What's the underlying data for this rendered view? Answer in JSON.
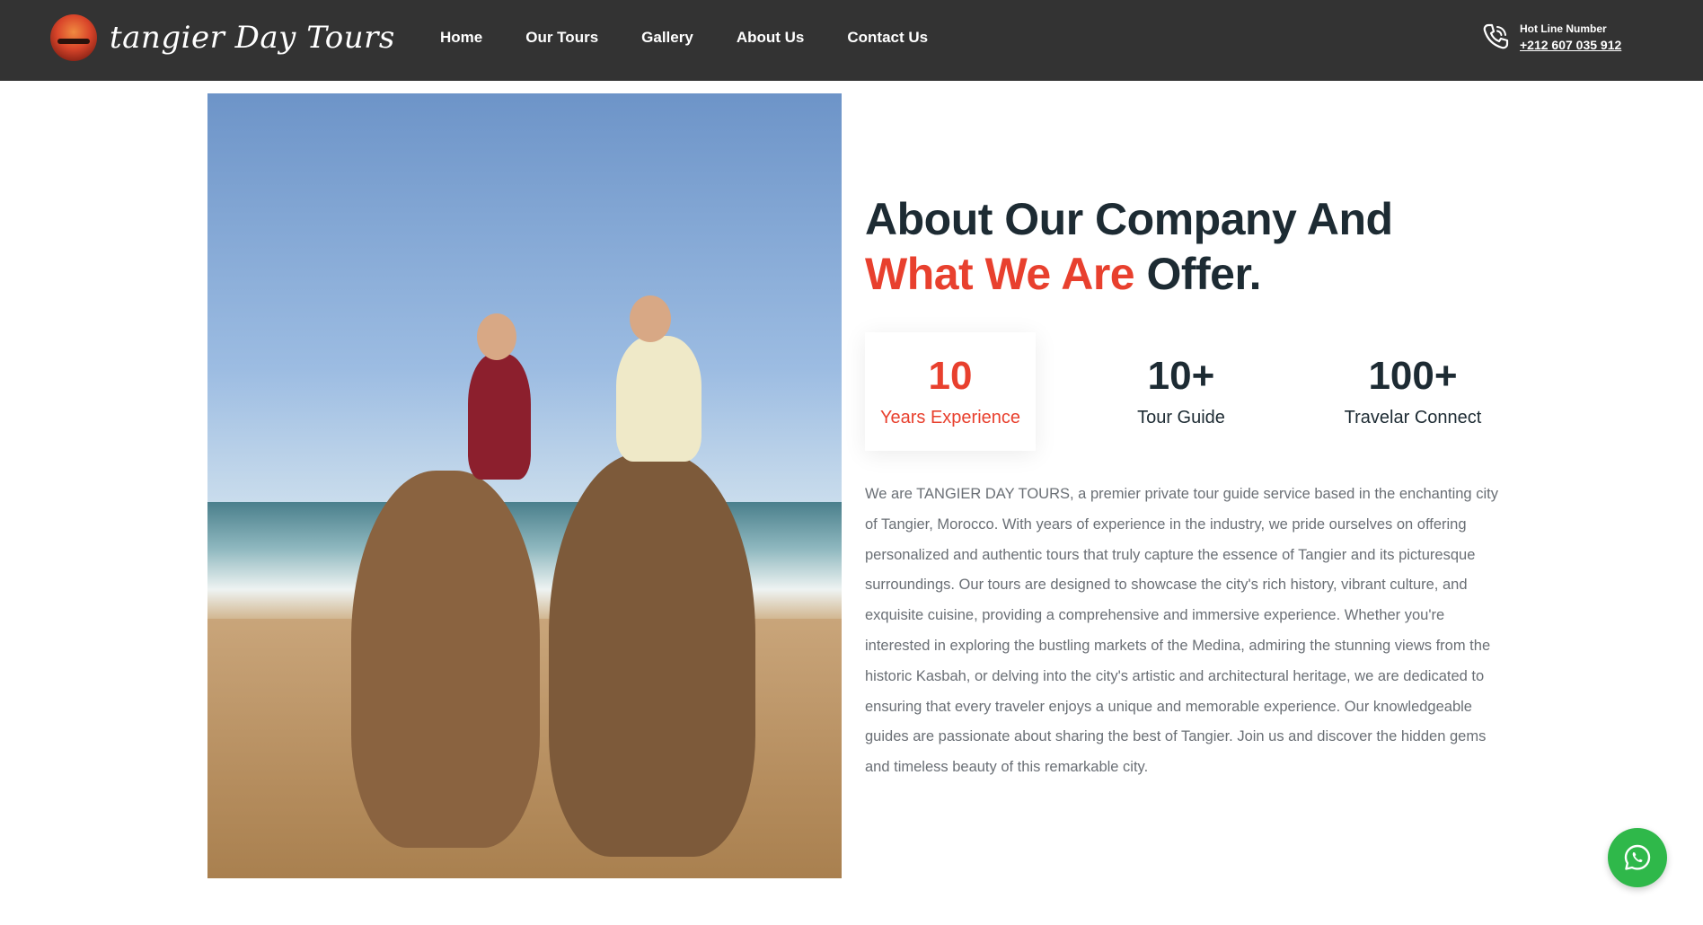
{
  "header": {
    "logo_text": "tangier Day Tours",
    "nav": [
      {
        "label": "Home"
      },
      {
        "label": "Our Tours"
      },
      {
        "label": "Gallery"
      },
      {
        "label": "About Us"
      },
      {
        "label": "Contact Us"
      }
    ],
    "hotline_label": "Hot Line Number",
    "hotline_number": "+212 607 035 912",
    "phone_icon": "phone-icon"
  },
  "about": {
    "heading_part1": "About Our Company And ",
    "heading_accent": "What We Are",
    "heading_part2": " Offer.",
    "stats": [
      {
        "value": "10",
        "label": "Years Experience"
      },
      {
        "value": "10+",
        "label": "Tour Guide"
      },
      {
        "value": "100+",
        "label": "Travelar Connect"
      }
    ],
    "description": "We are TANGIER DAY TOURS, a premier private tour guide service based in the enchanting city of Tangier, Morocco. With years of experience in the industry, we pride ourselves on offering personalized and authentic tours that truly capture the essence of Tangier and its picturesque surroundings. Our tours are designed to showcase the city's rich history, vibrant culture, and exquisite cuisine, providing a comprehensive and immersive experience. Whether you're interested in exploring the bustling markets of the Medina, admiring the stunning views from the historic Kasbah, or delving into the city's artistic and architectural heritage, we are dedicated to ensuring that every traveler enjoys a unique and memorable experience. Our knowledgeable guides are passionate about sharing the best of Tangier. Join us and discover the hidden gems and timeless beauty of this remarkable city."
  },
  "colors": {
    "header_bg": "#333333",
    "accent": "#e8402e",
    "heading": "#1d2b33",
    "body_text": "#6a6f75",
    "whatsapp": "#2fb84a"
  },
  "floating": {
    "whatsapp_icon": "whatsapp-icon"
  }
}
